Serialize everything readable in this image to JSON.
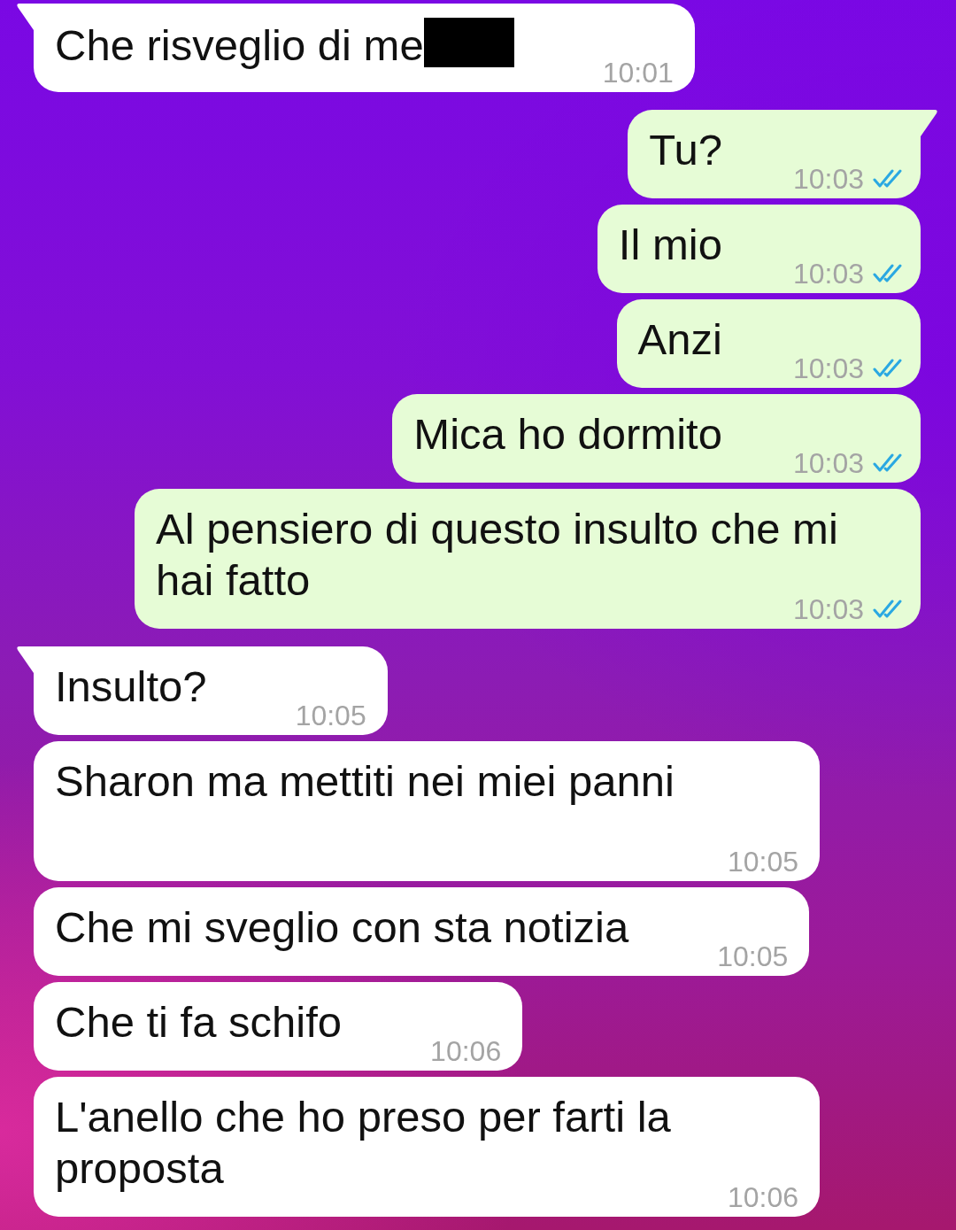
{
  "messages": [
    {
      "kind": "incoming",
      "text": "Che risveglio di me",
      "redacted": true,
      "time": "10:01"
    },
    {
      "kind": "outgoing",
      "text": "Tu?",
      "redacted": false,
      "time": "10:03",
      "read": true
    },
    {
      "kind": "outgoing",
      "text": "Il mio",
      "redacted": false,
      "time": "10:03",
      "read": true
    },
    {
      "kind": "outgoing",
      "text": "Anzi",
      "redacted": false,
      "time": "10:03",
      "read": true
    },
    {
      "kind": "outgoing",
      "text": "Mica ho dormito",
      "redacted": false,
      "time": "10:03",
      "read": true
    },
    {
      "kind": "outgoing",
      "text": "Al pensiero di questo insulto che mi hai fatto",
      "redacted": false,
      "time": "10:03",
      "read": true
    },
    {
      "kind": "incoming",
      "text": "Insulto?",
      "redacted": false,
      "time": "10:05"
    },
    {
      "kind": "incoming",
      "text": "Sharon ma mettiti nei miei panni",
      "redacted": false,
      "time": "10:05"
    },
    {
      "kind": "incoming",
      "text": "Che mi sveglio con sta notizia",
      "redacted": false,
      "time": "10:05"
    },
    {
      "kind": "incoming",
      "text": "Che ti fa schifo",
      "redacted": false,
      "time": "10:06"
    },
    {
      "kind": "incoming",
      "text": "L'anello che ho preso per farti la proposta",
      "redacted": false,
      "time": "10:06"
    }
  ]
}
